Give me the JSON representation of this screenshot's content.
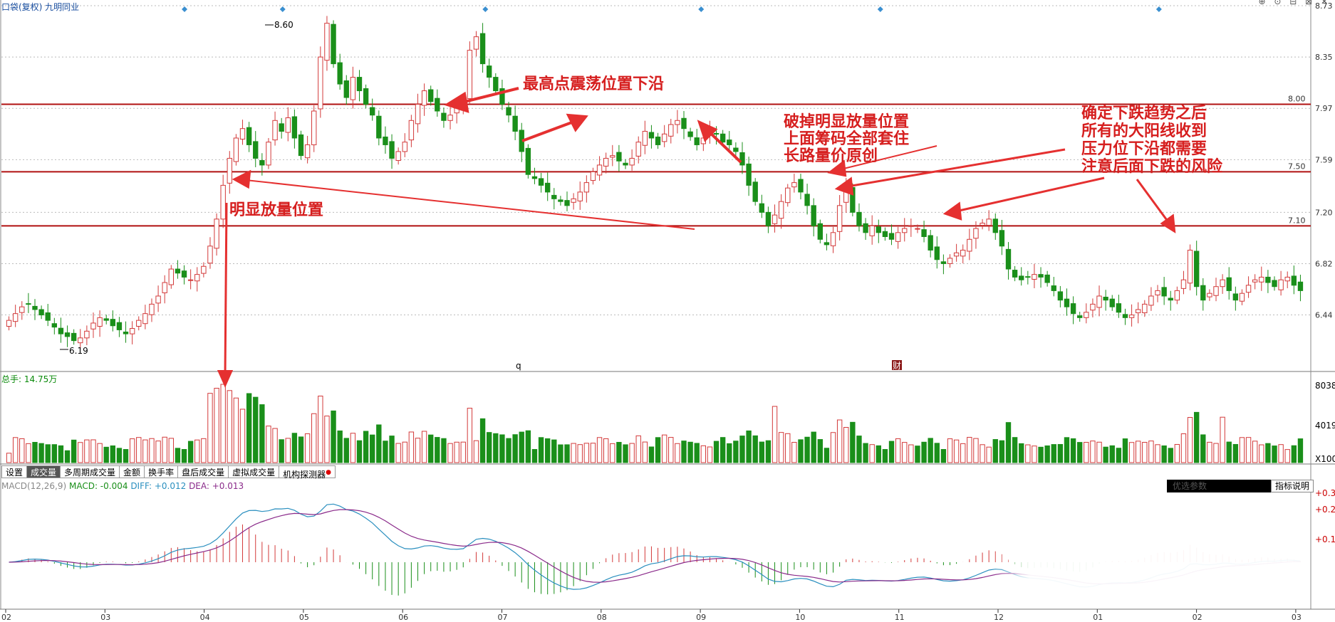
{
  "header": {
    "title": "口袋(复权) 九明同业"
  },
  "price_axis": {
    "labels": [
      "8.73",
      "8.35",
      "7.97",
      "7.59",
      "7.20",
      "6.82",
      "6.44"
    ]
  },
  "levels": [
    {
      "price": 8.0,
      "label": "8.00"
    },
    {
      "price": 7.5,
      "label": "7.50"
    },
    {
      "price": 7.1,
      "label": "7.10"
    }
  ],
  "price_marks": {
    "high": "8.60",
    "low": "6.19"
  },
  "annotations": {
    "a1": "最高点震荡位置下沿",
    "a2": "明显放量位置",
    "a3_lines": [
      "破掉明显放量位置",
      "上面筹码全部套住",
      "长路量价原创"
    ],
    "a4_lines": [
      "确定下跌趋势之后",
      "所有的大阳线收到",
      "压力位下沿都需要",
      "注意后面下跌的风险"
    ]
  },
  "chart_markers": {
    "q": "q",
    "cai": "财"
  },
  "volume": {
    "label": "总手: 14.75万",
    "axis": [
      "8038",
      "4019",
      "X100"
    ]
  },
  "tabs": {
    "t0": "设置",
    "t1": "成交量",
    "t2": "多周期成交量",
    "t3": "金额",
    "t4": "换手率",
    "t5": "盘后成交量",
    "t6": "虚拟成交量",
    "t7": "机构探测器"
  },
  "macd": {
    "name": "MACD(12,26,9)",
    "macd_value": "MACD: -0.004",
    "diff_value": "DIFF: +0.012",
    "dea_value": "DEA: +0.013",
    "axis": [
      "+0.3",
      "+0.2",
      "+0.1"
    ],
    "opt_button": "优选参数",
    "help_button": "指标说明"
  },
  "x_axis": {
    "labels": [
      "02",
      "03",
      "04",
      "05",
      "06",
      "07",
      "08",
      "09",
      "10",
      "11",
      "12",
      "01",
      "02",
      "03"
    ]
  },
  "colors": {
    "up": "#d33a3a",
    "down": "#1a8f1a",
    "level": "#b01010",
    "arrow": "#e53030",
    "diff": "#2a8fbf",
    "dea": "#8a2a8a"
  },
  "chart_data": {
    "type": "candlestick",
    "ylim": [
      6.19,
      8.73
    ],
    "closes": [
      6.4,
      6.45,
      6.5,
      6.52,
      6.48,
      6.44,
      6.4,
      6.35,
      6.3,
      6.28,
      6.25,
      6.27,
      6.32,
      6.38,
      6.42,
      6.4,
      6.36,
      6.33,
      6.3,
      6.34,
      6.4,
      6.45,
      6.52,
      6.58,
      6.68,
      6.78,
      6.75,
      6.72,
      6.7,
      6.74,
      6.8,
      6.95,
      7.15,
      7.4,
      7.6,
      7.75,
      7.82,
      7.7,
      7.6,
      7.55,
      7.72,
      7.88,
      7.8,
      7.9,
      7.75,
      7.62,
      7.7,
      7.95,
      8.35,
      8.6,
      8.3,
      8.15,
      8.05,
      8.2,
      8.1,
      8.0,
      7.92,
      7.75,
      7.7,
      7.6,
      7.65,
      7.72,
      7.88,
      8.0,
      8.1,
      8.02,
      7.95,
      7.88,
      7.92,
      7.98,
      8.05,
      8.4,
      8.5,
      8.3,
      8.2,
      8.1,
      8.0,
      7.92,
      7.8,
      7.65,
      7.48,
      7.45,
      7.4,
      7.35,
      7.3,
      7.28,
      7.25,
      7.3,
      7.35,
      7.42,
      7.5,
      7.55,
      7.6,
      7.62,
      7.58,
      7.55,
      7.6,
      7.72,
      7.8,
      7.75,
      7.7,
      7.78,
      7.85,
      7.88,
      7.82,
      7.76,
      7.7,
      7.75,
      7.8,
      7.78,
      7.72,
      7.7,
      7.65,
      7.55,
      7.4,
      7.28,
      7.2,
      7.1,
      7.18,
      7.28,
      7.38,
      7.42,
      7.35,
      7.25,
      7.1,
      7.0,
      6.96,
      7.05,
      7.25,
      7.4,
      7.2,
      7.1,
      7.05,
      7.1,
      7.05,
      7.02,
      7.0,
      7.05,
      7.08,
      7.1,
      7.08,
      7.02,
      6.92,
      6.85,
      6.82,
      6.86,
      6.9,
      6.92,
      7.0,
      7.08,
      7.12,
      7.15,
      7.05,
      6.95,
      6.78,
      6.72,
      6.7,
      6.72,
      6.74,
      6.72,
      6.68,
      6.62,
      6.55,
      6.5,
      6.45,
      6.42,
      6.46,
      6.52,
      6.58,
      6.55,
      6.5,
      6.46,
      6.42,
      6.44,
      6.48,
      6.52,
      6.58,
      6.62,
      6.58,
      6.55,
      6.62,
      6.7,
      6.92,
      6.65,
      6.55,
      6.6,
      6.65,
      6.7,
      6.62,
      6.55,
      6.6,
      6.66,
      6.7,
      6.72,
      6.68,
      6.65,
      6.7,
      6.72,
      6.66,
      6.62
    ]
  }
}
